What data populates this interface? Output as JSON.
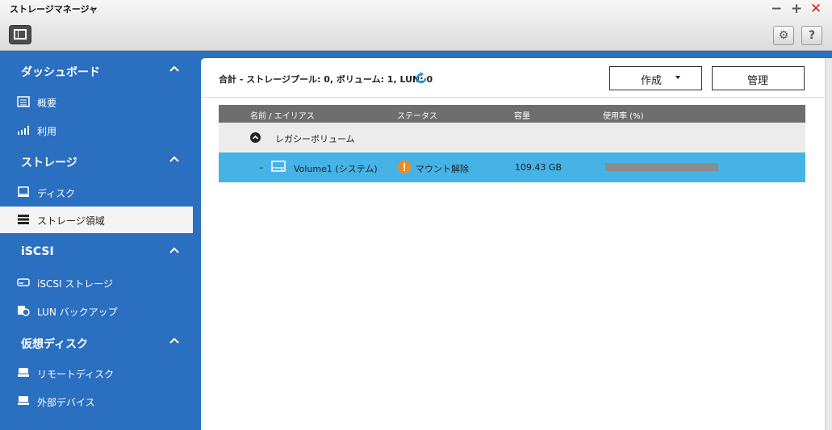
{
  "window": {
    "title": "ストレージマネージャ",
    "minimize_label": "−",
    "maximize_label": "+",
    "close_label": "✕"
  },
  "toolbar": {
    "settings_icon": "gear-icon",
    "help_label": "?"
  },
  "sidebar": {
    "sections": [
      {
        "label": "ダッシュボード",
        "items": [
          {
            "label": "概要",
            "icon": "overview-icon"
          },
          {
            "label": "利用",
            "icon": "usage-chart-icon"
          }
        ]
      },
      {
        "label": "ストレージ",
        "items": [
          {
            "label": "ディスク",
            "icon": "disk-icon"
          },
          {
            "label": "ストレージ領域",
            "icon": "storage-space-icon",
            "active": true
          }
        ]
      },
      {
        "label": "iSCSI",
        "items": [
          {
            "label": "iSCSI ストレージ",
            "icon": "iscsi-storage-icon"
          },
          {
            "label": "LUN バックアップ",
            "icon": "lun-backup-icon"
          }
        ]
      },
      {
        "label": "仮想ディスク",
        "items": [
          {
            "label": "リモートディスク",
            "icon": "remote-disk-icon"
          },
          {
            "label": "外部デバイス",
            "icon": "external-device-icon"
          }
        ]
      }
    ]
  },
  "main": {
    "summary": "合計 - ストレージプール: 0, ボリューム: 1, LUN: 0",
    "create_label": "作成",
    "manage_label": "管理",
    "columns": [
      "名前 / エイリアス",
      "ステータス",
      "容量",
      "使用率 (%)"
    ],
    "group_label": "レガシーボリューム",
    "rows": [
      {
        "expander": "–",
        "name": "Volume1 (システム)",
        "status": "マウント解除",
        "capacity": "109.43 GB",
        "usage_percent": 100
      }
    ]
  },
  "colors": {
    "sidebar_bg": "#2a6fc0",
    "selected_row": "#45b3e6",
    "warning": "#f08a1c",
    "header_row": "#6e6e6e"
  }
}
